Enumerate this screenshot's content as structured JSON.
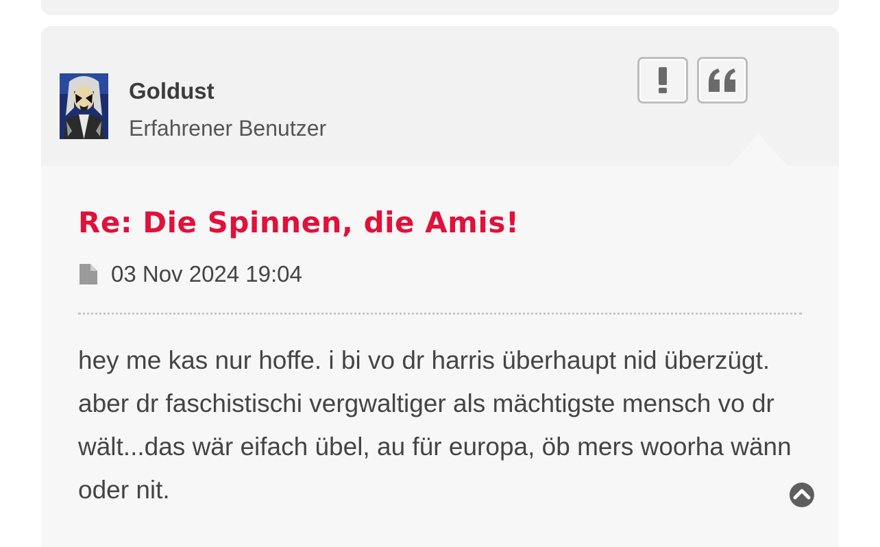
{
  "post": {
    "author": {
      "name": "Goldust",
      "rank": "Erfahrener Benutzer",
      "avatar": "avatar-image"
    },
    "actions": {
      "report_icon": "exclamation-icon",
      "quote_icon": "quote-icon"
    },
    "title": "Re: Die Spinnen, die Amis!",
    "date": "03 Nov 2024 19:04",
    "date_icon": "document-icon",
    "content": "hey me kas nur hoffe. i bi vo dr harris überhaupt nid überzügt. aber dr faschistischi vergwaltiger als mächtigste mensch vo dr wält...das wär eifach übel, au für europa, öb mers woorha wänn oder nit.",
    "back_to_top_icon": "chevron-up-circle-icon"
  },
  "colors": {
    "title": "#e0113a",
    "header_bg": "#f2f2f2",
    "body_bg": "#f7f7f7",
    "text": "#444444",
    "button_border": "#bdbdbd"
  }
}
